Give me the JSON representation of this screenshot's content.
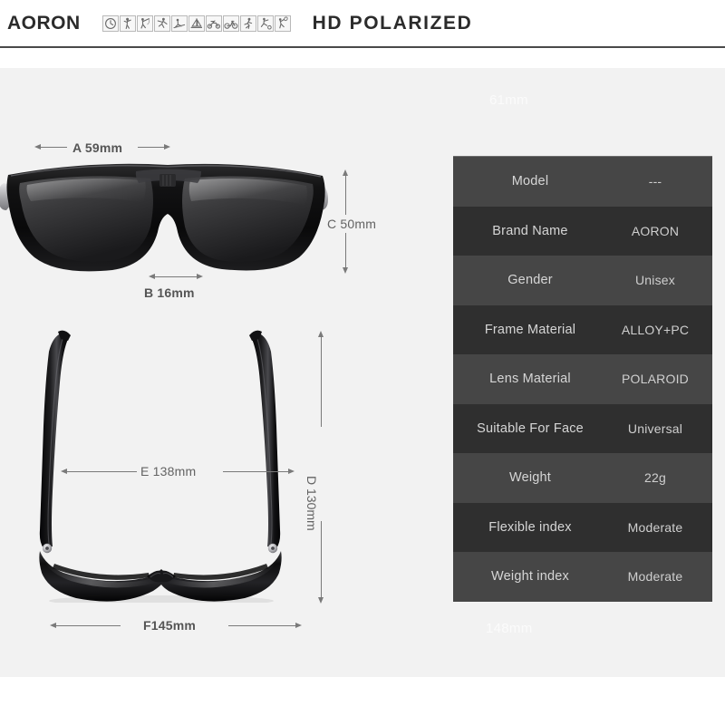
{
  "header": {
    "brand": "AORON",
    "tagline": "HD POLARIZED",
    "icons": [
      "clock-icon",
      "golf-icon",
      "fishing-icon",
      "baseball-icon",
      "skiing-icon",
      "sailing-icon",
      "motorcycle-icon",
      "cycling-icon",
      "running-icon",
      "soccer-icon",
      "tennis-icon"
    ]
  },
  "watermarks": {
    "top": "61mm",
    "bottom": "148mm"
  },
  "dimensions": {
    "a": "A 59mm",
    "b": "B 16mm",
    "c": "C 50mm",
    "d": "D 130mm",
    "e": "E 138mm",
    "f": "F145mm"
  },
  "spec_table": {
    "rows": [
      {
        "key": "Model",
        "value": "---"
      },
      {
        "key": "Brand Name",
        "value": "AORON"
      },
      {
        "key": "Gender",
        "value": "Unisex"
      },
      {
        "key": "Frame Material",
        "value": "ALLOY+PC"
      },
      {
        "key": "Lens Material",
        "value": "POLAROID"
      },
      {
        "key": "Suitable For Face",
        "value": "Universal"
      },
      {
        "key": "Weight",
        "value": "22g"
      },
      {
        "key": "Flexible index",
        "value": "Moderate"
      },
      {
        "key": "Weight index",
        "value": "Moderate"
      }
    ]
  },
  "colors": {
    "page_background": "#ffffff",
    "stage_background": "#f2f2f2",
    "table_row_light": "#464646",
    "table_row_dark": "#2f2f2f",
    "table_text": "#d6d6d6",
    "dimension_text": "#636363",
    "header_text": "#2b2b2b",
    "rule": "#4a4a4a"
  }
}
